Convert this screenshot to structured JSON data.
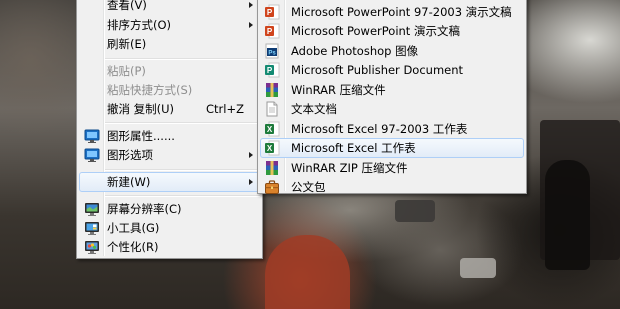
{
  "context_menu": {
    "items": [
      {
        "label": "查看(V)",
        "submenu": true
      },
      {
        "label": "排序方式(O)",
        "submenu": true
      },
      {
        "label": "刷新(E)"
      },
      {
        "label": "粘贴(P)",
        "disabled": true
      },
      {
        "label": "粘贴快捷方式(S)",
        "disabled": true
      },
      {
        "label": "撤消 复制(U)",
        "shortcut": "Ctrl+Z"
      },
      {
        "label": "图形属性......",
        "icon": "graphics-properties-icon"
      },
      {
        "label": "图形选项",
        "icon": "graphics-options-icon",
        "submenu": true
      },
      {
        "label": "新建(W)",
        "submenu": true,
        "highlighted": true
      },
      {
        "label": "屏幕分辨率(C)",
        "icon": "screen-resolution-icon"
      },
      {
        "label": "小工具(G)",
        "icon": "gadgets-icon"
      },
      {
        "label": "个性化(R)",
        "icon": "personalize-icon"
      }
    ]
  },
  "new_submenu": {
    "items": [
      {
        "label": "Microsoft PowerPoint 97-2003 演示文稿",
        "icon": "powerpoint-icon"
      },
      {
        "label": "Microsoft PowerPoint 演示文稿",
        "icon": "powerpoint-icon"
      },
      {
        "label": "Adobe Photoshop 图像",
        "icon": "photoshop-icon"
      },
      {
        "label": "Microsoft Publisher Document",
        "icon": "publisher-icon"
      },
      {
        "label": "WinRAR 压缩文件",
        "icon": "winrar-icon"
      },
      {
        "label": "文本文档",
        "icon": "text-document-icon"
      },
      {
        "label": "Microsoft Excel 97-2003 工作表",
        "icon": "excel-icon"
      },
      {
        "label": "Microsoft Excel 工作表",
        "icon": "excel-icon",
        "highlighted": true
      },
      {
        "label": "WinRAR ZIP 压缩文件",
        "icon": "winrar-zip-icon"
      },
      {
        "label": "公文包",
        "icon": "briefcase-icon"
      }
    ]
  },
  "colors": {
    "menu_background": "#f0f0f0",
    "highlight_border": "#aecff7",
    "disabled_text": "#8e8e8e"
  }
}
